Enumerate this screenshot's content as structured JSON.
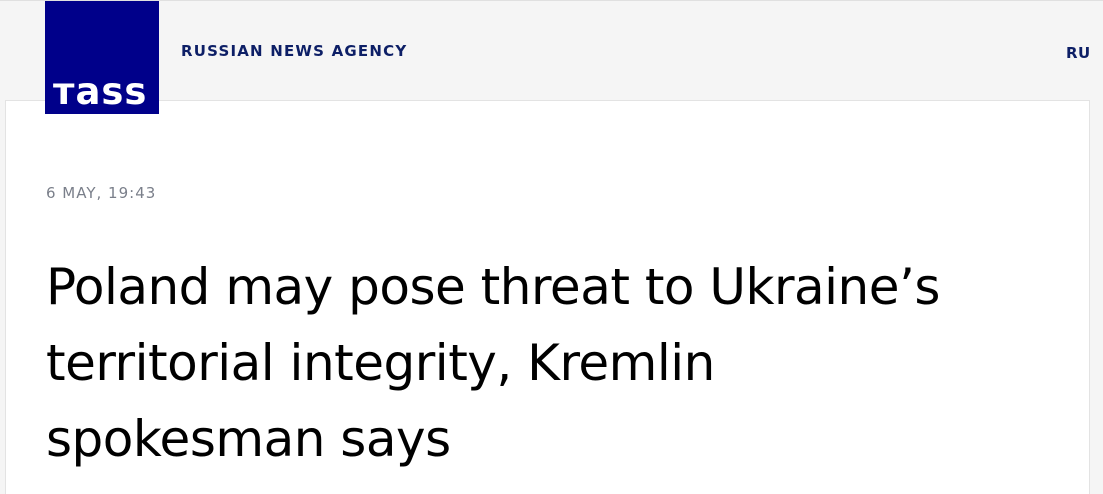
{
  "header": {
    "logo_text": "тass",
    "agency_name": "RUSSIAN NEWS AGENCY",
    "language": "RU"
  },
  "article": {
    "date": "6 MAY, 19:43",
    "title_lines": [
      "Poland may pose threat to Ukraine’s",
      "territorial integrity, Kremlin",
      "spokesman says"
    ]
  },
  "colors": {
    "brand": "#00008a",
    "nav_text": "#0d1f66",
    "date_text": "#7a7f8a",
    "page_background": "#f5f5f5",
    "card_background": "#ffffff"
  }
}
